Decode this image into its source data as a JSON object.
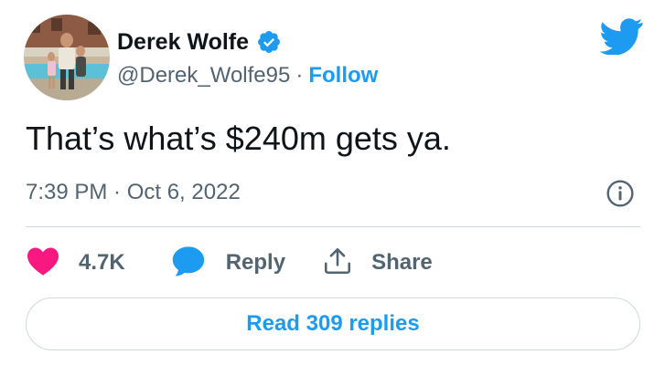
{
  "author": {
    "display_name": "Derek Wolfe",
    "handle": "@Derek_Wolfe95",
    "separator": "·",
    "follow_label": "Follow",
    "verified": true
  },
  "icons": {
    "verified": "verified-badge-icon",
    "brand": "twitter-bird-icon",
    "info": "info-icon",
    "like": "heart-icon",
    "reply": "speech-bubble-icon",
    "share": "share-upload-icon"
  },
  "tweet": {
    "text": "That’s what’s $240m gets ya.",
    "timestamp": "7:39 PM · Oct 6, 2022"
  },
  "actions": {
    "likes_count": "4.7K",
    "reply_label": "Reply",
    "share_label": "Share"
  },
  "read_replies_label": "Read 309 replies",
  "colors": {
    "accent": "#1d9bf0",
    "like": "#f91880",
    "text": "#0f1419",
    "secondary": "#536471",
    "border": "#cfd9de"
  }
}
